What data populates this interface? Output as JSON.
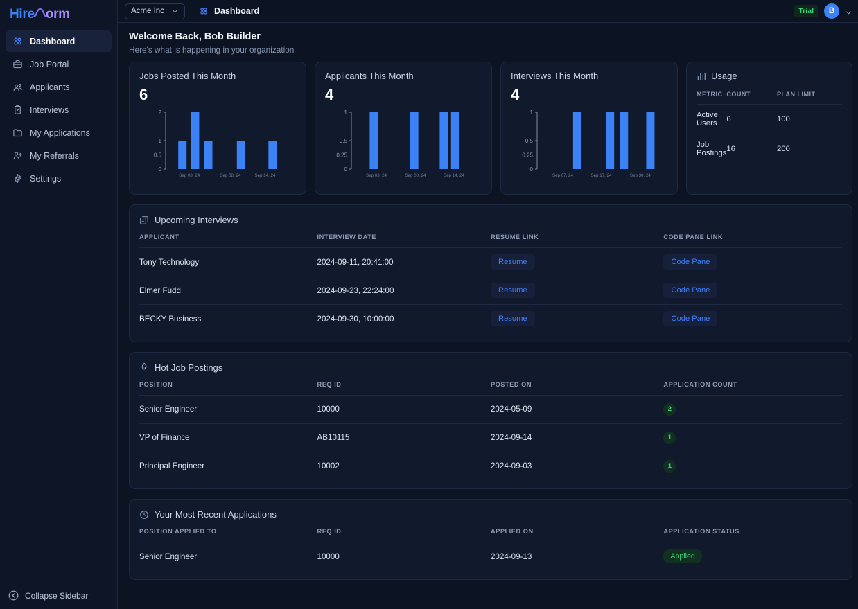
{
  "sidebar": {
    "logo": {
      "part1": "Hire",
      "part2": "orm"
    },
    "items": [
      {
        "label": "Dashboard",
        "icon": "grid-icon",
        "active": true
      },
      {
        "label": "Job Portal",
        "icon": "briefcase-icon",
        "active": false
      },
      {
        "label": "Applicants",
        "icon": "users-icon",
        "active": false
      },
      {
        "label": "Interviews",
        "icon": "clipboard-icon",
        "active": false
      },
      {
        "label": "My Applications",
        "icon": "folder-icon",
        "active": false
      },
      {
        "label": "My Referrals",
        "icon": "user-plus-icon",
        "active": false
      },
      {
        "label": "Settings",
        "icon": "gear-icon",
        "active": false
      }
    ],
    "collapse_label": "Collapse Sidebar"
  },
  "topbar": {
    "org_name": "Acme Inc",
    "breadcrumb": "Dashboard",
    "trial_badge": "Trial",
    "avatar_initial": "B"
  },
  "welcome": {
    "title": "Welcome Back, Bob Builder",
    "subtitle": "Here's what is happening in your organization"
  },
  "chart_data": [
    {
      "type": "bar",
      "title": "Jobs Posted This Month",
      "big_value": "6",
      "xlabel": "",
      "ylabel": "",
      "yticks": [
        "0",
        "0.5",
        "1",
        "2"
      ],
      "ytick_values": [
        0,
        0.5,
        1,
        2
      ],
      "ylim": [
        0,
        2
      ],
      "xtick_labels": [
        "Sep 03, 24",
        "Sep 08, 24",
        "Sep 14, 24"
      ],
      "xtick_positions": [
        0.155,
        0.48,
        0.755
      ],
      "categories": [
        "slot1",
        "slot2",
        "slot3",
        "slot4",
        "slot5"
      ],
      "values": [
        1,
        2,
        1,
        1,
        1
      ],
      "bar_x": [
        0.1,
        0.2,
        0.305,
        0.565,
        0.815
      ],
      "grid": false,
      "color": "#3b82f6"
    },
    {
      "type": "bar",
      "title": "Applicants This Month",
      "big_value": "4",
      "xlabel": "",
      "ylabel": "",
      "yticks": [
        "0",
        "0.25",
        "0.5",
        "1"
      ],
      "ytick_values": [
        0,
        0.25,
        0.5,
        1
      ],
      "ylim": [
        0,
        1
      ],
      "xtick_labels": [
        "Sep 03, 24",
        "Sep 08, 24",
        "Sep 14, 24"
      ],
      "xtick_positions": [
        0.165,
        0.475,
        0.78
      ],
      "categories": [
        "slot1",
        "slot2",
        "slot3",
        "slot4"
      ],
      "values": [
        1,
        1,
        1,
        1
      ],
      "bar_x": [
        0.145,
        0.465,
        0.7,
        0.79
      ],
      "grid": false,
      "color": "#3b82f6"
    },
    {
      "type": "bar",
      "title": "Interviews This Month",
      "big_value": "4",
      "xlabel": "",
      "ylabel": "",
      "yticks": [
        "0",
        "0.25",
        "0.5",
        "1"
      ],
      "ytick_values": [
        0,
        0.25,
        0.5,
        1
      ],
      "ylim": [
        0,
        1
      ],
      "xtick_labels": [
        "Sep 07, 24",
        "Sep 17, 24",
        "Sep 30, 24"
      ],
      "xtick_positions": [
        0.17,
        0.475,
        0.785
      ],
      "categories": [
        "slot1",
        "slot2",
        "slot3",
        "slot4"
      ],
      "values": [
        1,
        1,
        1,
        1
      ],
      "bar_x": [
        0.285,
        0.545,
        0.655,
        0.865
      ],
      "grid": false,
      "color": "#3b82f6"
    }
  ],
  "usage": {
    "title": "Usage",
    "columns": [
      "METRIC",
      "COUNT",
      "PLAN LIMIT"
    ],
    "rows": [
      {
        "metric": "Active Users",
        "count": "6",
        "limit": "100"
      },
      {
        "metric": "Job Postings",
        "count": "16",
        "limit": "200"
      }
    ]
  },
  "upcoming_interviews": {
    "title": "Upcoming Interviews",
    "columns": [
      "APPLICANT",
      "INTERVIEW DATE",
      "RESUME LINK",
      "CODE PANE LINK"
    ],
    "rows": [
      {
        "applicant": "Tony Technology",
        "date": "2024-09-11, 20:41:00",
        "resume": "Resume",
        "code_pane": "Code Pane"
      },
      {
        "applicant": "Elmer Fudd",
        "date": "2024-09-23, 22:24:00",
        "resume": "Resume",
        "code_pane": "Code Pane"
      },
      {
        "applicant": "BECKY Business",
        "date": "2024-09-30, 10:00:00",
        "resume": "Resume",
        "code_pane": "Code Pane"
      }
    ]
  },
  "hot_job_postings": {
    "title": "Hot Job Postings",
    "columns": [
      "POSITION",
      "REQ ID",
      "POSTED ON",
      "APPLICATION COUNT"
    ],
    "rows": [
      {
        "position": "Senior Engineer",
        "req_id": "10000",
        "posted_on": "2024-05-09",
        "count": "2"
      },
      {
        "position": "VP of Finance",
        "req_id": "AB10115",
        "posted_on": "2024-09-14",
        "count": "1"
      },
      {
        "position": "Principal Engineer",
        "req_id": "10002",
        "posted_on": "2024-09-03",
        "count": "1"
      }
    ]
  },
  "recent_applications": {
    "title": "Your Most Recent Applications",
    "columns": [
      "POSITION APPLIED TO",
      "REQ ID",
      "APPLIED ON",
      "APPLICATION STATUS"
    ],
    "rows": [
      {
        "position": "Senior Engineer",
        "req_id": "10000",
        "applied_on": "2024-09-13",
        "status": "Applied"
      }
    ]
  },
  "colors": {
    "accent": "#3b82f6",
    "purple": "#a78bfa",
    "green": "#3dd17f",
    "panel_bg": "#111a2c",
    "page_bg": "#0c1322"
  }
}
